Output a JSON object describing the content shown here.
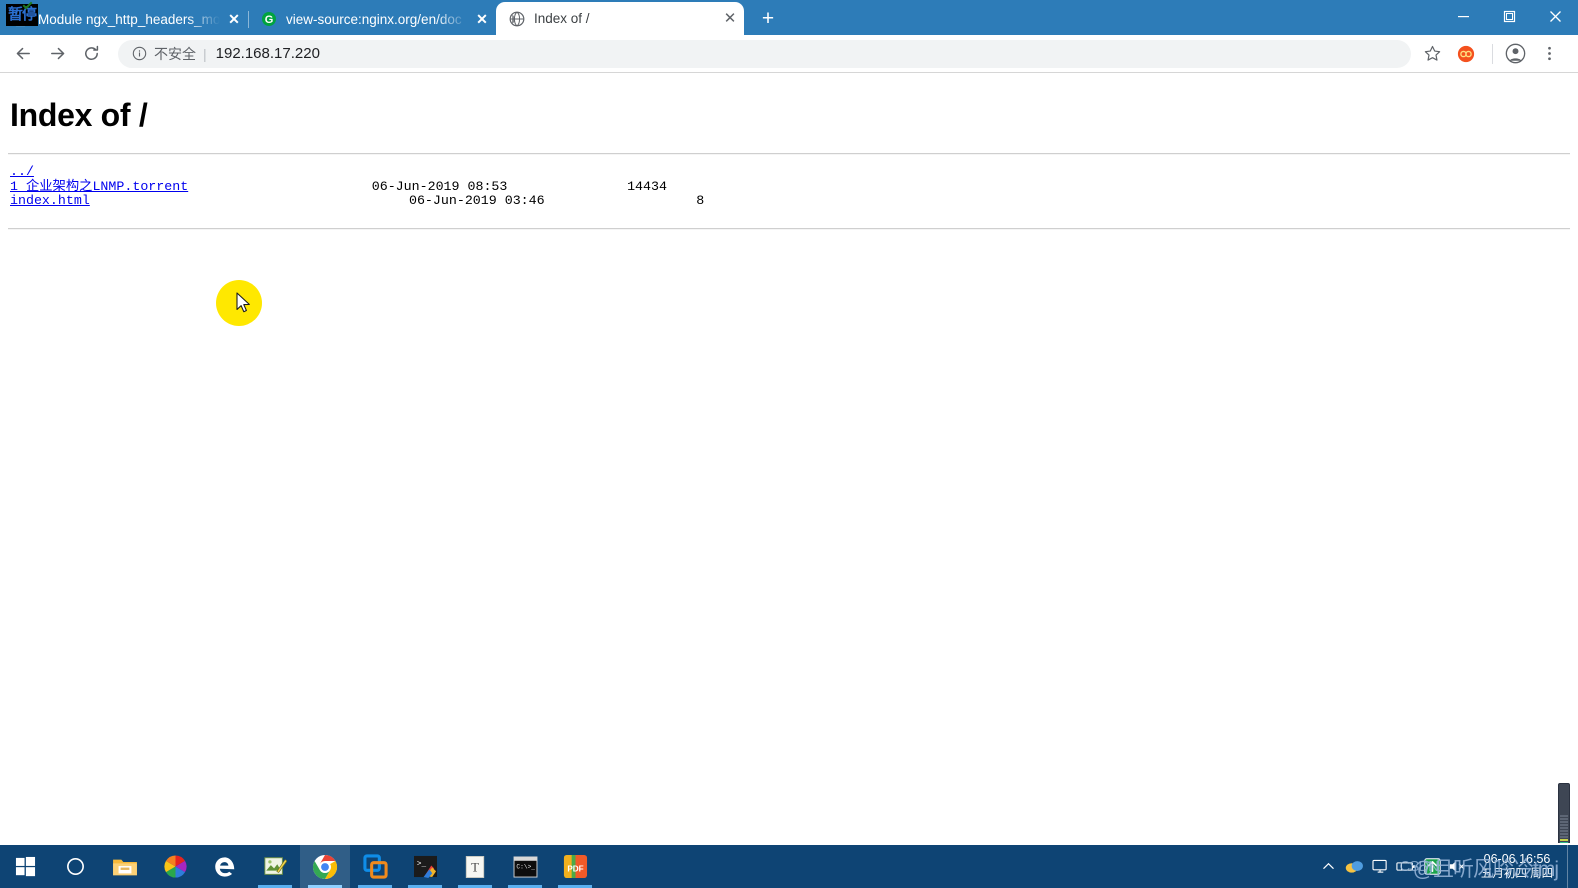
{
  "window": {
    "minimize_label": "─",
    "restore_label": "❐",
    "close_label": "✕"
  },
  "recorder": {
    "badge_label": "暂停"
  },
  "tabs": [
    {
      "title": "Module ngx_http_headers_mo",
      "favicon": "document-icon",
      "close_label": "✕",
      "active": false
    },
    {
      "title": "view-source:nginx.org/en/doc",
      "favicon": "green-g-icon",
      "close_label": "✕",
      "active": false
    },
    {
      "title": "Index of /",
      "favicon": "globe-icon",
      "close_label": "✕",
      "active": true
    }
  ],
  "newtab": {
    "label": "+"
  },
  "toolbar": {
    "back_label": "←",
    "forward_label": "→",
    "reload_label": "↻",
    "security_text": "不安全",
    "separator": "|",
    "url": "192.168.17.220",
    "bookmark_label": "☆",
    "extension_label": "∞",
    "profile_label": "account-icon",
    "menu_label": "⋮"
  },
  "page": {
    "heading": "Index of /",
    "listing": "<a href=\"#\">../</a>\n<a href=\"#\">1 企业架构之LNMP.torrent</a>                       06-Jun-2019 08:53               14434\n<a href=\"#\">index.html</a>                                        06-Jun-2019 03:46                   8"
  },
  "files": [
    {
      "name": "../",
      "date": "",
      "size": ""
    },
    {
      "name": "1 企业架构之LNMP.torrent",
      "date": "06-Jun-2019 08:53",
      "size": "14434"
    },
    {
      "name": "index.html",
      "date": "06-Jun-2019 03:46",
      "size": "8"
    }
  ],
  "taskbar": {
    "items": [
      {
        "name": "start-button",
        "icon": "windows-logo-icon",
        "state": "idle"
      },
      {
        "name": "cortana-search",
        "icon": "circle-icon",
        "state": "idle"
      },
      {
        "name": "file-explorer",
        "icon": "folder-icon",
        "state": "idle"
      },
      {
        "name": "pinwheel-app",
        "icon": "pinwheel-icon",
        "state": "idle"
      },
      {
        "name": "microsoft-edge",
        "icon": "edge-icon",
        "state": "idle"
      },
      {
        "name": "notepad-plus-app",
        "icon": "notepad-icon",
        "state": "running"
      },
      {
        "name": "google-chrome",
        "icon": "chrome-icon",
        "state": "active"
      },
      {
        "name": "vmware-workstation",
        "icon": "vmware-icon",
        "state": "running"
      },
      {
        "name": "xshell-app",
        "icon": "terminal-color-icon",
        "state": "running"
      },
      {
        "name": "typora-app",
        "icon": "letter-t-icon",
        "state": "running"
      },
      {
        "name": "xftp-console",
        "icon": "console-icon",
        "state": "running"
      },
      {
        "name": "pdf-reader",
        "icon": "pdf-icon",
        "state": "running"
      }
    ],
    "tray": [
      {
        "name": "show-hidden-icons",
        "glyph": "∧"
      },
      {
        "name": "onedrive-icon",
        "glyph": "●"
      },
      {
        "name": "network-monitor-icon",
        "glyph": "☐"
      },
      {
        "name": "battery-icon",
        "glyph": "▭"
      },
      {
        "name": "update-arrow-icon",
        "glyph": "↑"
      },
      {
        "name": "volume-muted-icon",
        "glyph": "🔇"
      }
    ],
    "clock": {
      "time": "06-06 16:56",
      "lunar_date": "五月初四 周四"
    },
    "watermark": "@且听风吟冷tmj",
    "watermark_small": "CSDN"
  },
  "colors": {
    "chrome_tabstrip": "#2d7cb8",
    "taskbar": "#0e4474",
    "link": "#0000ee",
    "accent_active_tab_underline": "#8fd0ff"
  }
}
